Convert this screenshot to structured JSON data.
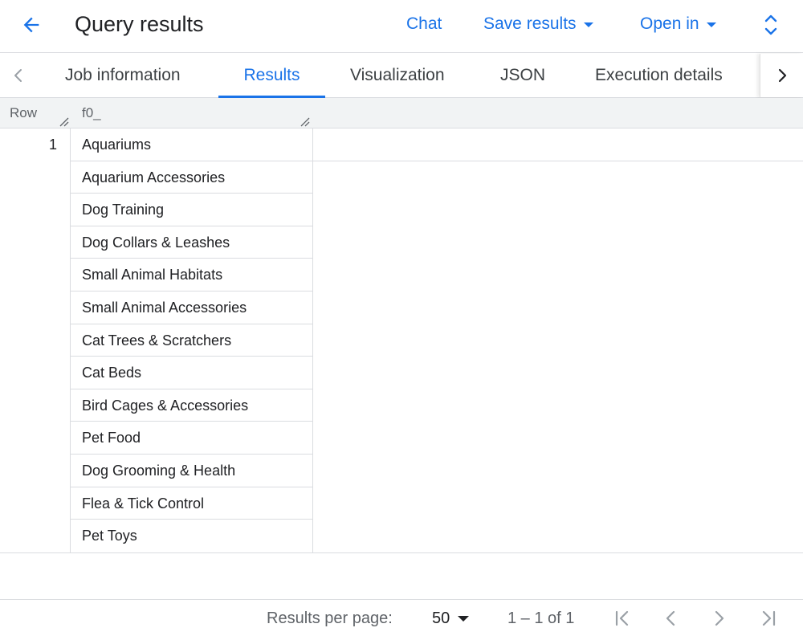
{
  "header": {
    "title": "Query results",
    "chat_label": "Chat",
    "save_label": "Save results",
    "open_label": "Open in"
  },
  "tabs": [
    {
      "label": "Job information"
    },
    {
      "label": "Results",
      "active": true
    },
    {
      "label": "Visualization"
    },
    {
      "label": "JSON"
    },
    {
      "label": "Execution details"
    }
  ],
  "table": {
    "columns": [
      "Row",
      "f0_"
    ],
    "row_number": "1",
    "values": [
      "Aquariums",
      "Aquarium Accessories",
      "Dog Training",
      "Dog Collars & Leashes",
      "Small Animal Habitats",
      "Small Animal Accessories",
      "Cat Trees & Scratchers",
      "Cat Beds",
      "Bird Cages & Accessories",
      "Pet Food",
      "Dog Grooming & Health",
      "Flea & Tick Control",
      "Pet Toys"
    ]
  },
  "footer": {
    "per_page_label": "Results per page:",
    "per_page_value": "50",
    "range_text": "1 – 1 of 1"
  },
  "colors": {
    "accent": "#1a73e8",
    "border": "#dadce0",
    "header_bg": "#f1f3f4"
  },
  "icons": {
    "back": "arrow-left-icon",
    "expand": "unfold-icon",
    "tab_prev": "chevron-left-icon",
    "tab_next": "chevron-right-icon",
    "first_page": "first-page-icon",
    "prev_page": "chevron-left-icon",
    "next_page": "chevron-right-icon",
    "last_page": "last-page-icon"
  }
}
